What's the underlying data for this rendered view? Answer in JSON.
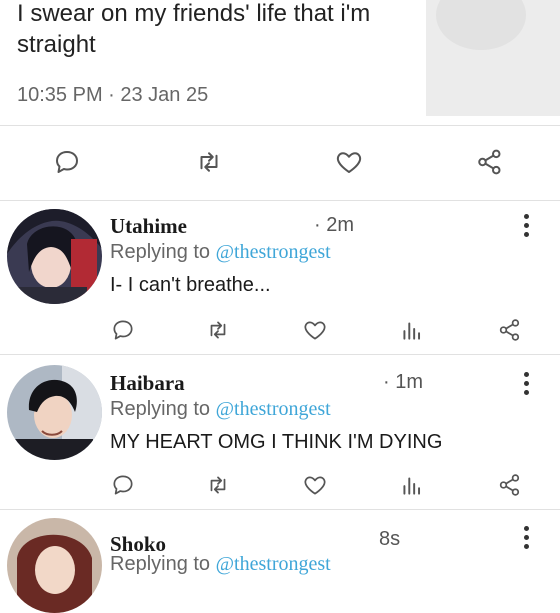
{
  "main_tweet": {
    "text": "I swear on my friends' life that i'm straight",
    "meta": "10:35 PM · 23 Jan 25"
  },
  "replies": [
    {
      "name": "Utahime",
      "time": "· 2m",
      "replying_prefix": "Replying to",
      "handle": "@thestrongest",
      "text": "I- I can't breathe..."
    },
    {
      "name": "Haibara",
      "time": "· 1m",
      "replying_prefix": "Replying to",
      "handle": "@thestrongest",
      "text": "MY HEART OMG I THINK I'M DYING"
    },
    {
      "name": "Shoko",
      "time": "8s",
      "replying_prefix": "Replying to",
      "handle": "@thestrongest",
      "text": ""
    }
  ],
  "colors": {
    "accent": "#3fa6d8",
    "divider": "#e1e1e1",
    "icon": "#555555"
  },
  "icons": [
    "reply-icon",
    "retweet-icon",
    "like-icon",
    "share-icon",
    "views-icon",
    "more-icon"
  ]
}
